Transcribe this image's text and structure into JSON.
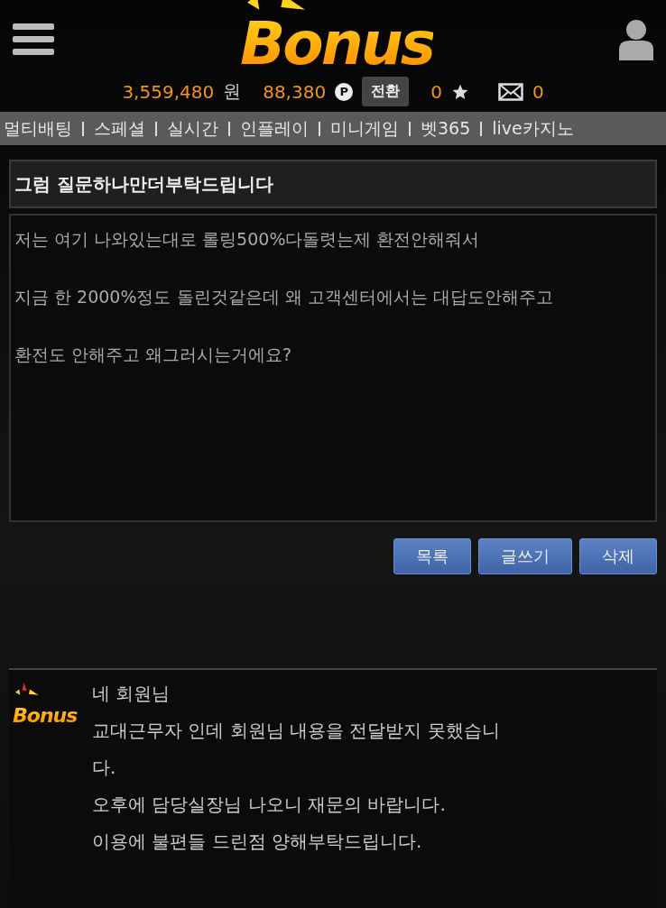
{
  "header": {
    "logo": "Bonus",
    "balance": "3,559,480",
    "currency": "원",
    "points": "88,380",
    "point_icon": "P",
    "convert_button": "전환",
    "stars": "0",
    "messages": "0"
  },
  "nav": [
    "멀티배팅",
    "스페셜",
    "실시간",
    "인플레이",
    "미니게임",
    "벳365",
    "live카지노"
  ],
  "post": {
    "title": "그럼 질문하나만더부탁드립니다",
    "paragraphs": [
      "저는 여기 나와있는대로 롤링500%다돌렷는제 환전안해줘서",
      "지금 한 2000%정도 돌린것같은데 왜 고객센터에서는 대답도안해주고",
      "환전도 안해주고 왜그러시는거에요?"
    ]
  },
  "buttons": [
    "목록",
    "글쓰기",
    "삭제"
  ],
  "reply": {
    "logo": "Bonus",
    "lines": [
      "네 회원님",
      "교대근무자 인데 회원님 내용을 전달받지 못했습니",
      "다.",
      "오후에 담당실장님 나오니 재문의 바랍니다.",
      "이용에 불편들 드린점 양해부탁드립니다."
    ]
  }
}
